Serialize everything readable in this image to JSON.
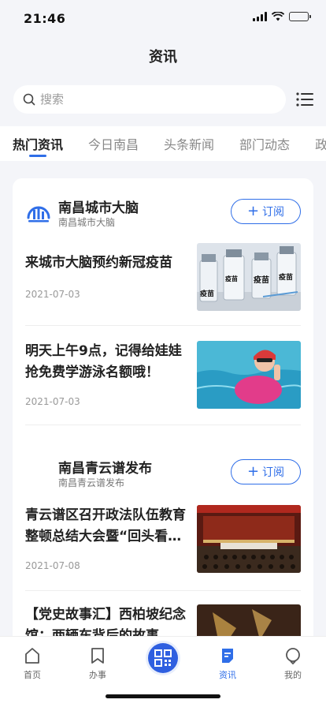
{
  "status_bar": {
    "time": "21:46"
  },
  "header": {
    "title": "资讯"
  },
  "search": {
    "placeholder": "搜索"
  },
  "tabs": [
    {
      "label": "热门资讯",
      "active": true
    },
    {
      "label": "今日南昌",
      "active": false
    },
    {
      "label": "头条新闻",
      "active": false
    },
    {
      "label": "部门动态",
      "active": false
    },
    {
      "label": "政",
      "active": false
    }
  ],
  "channels": [
    {
      "name": "南昌城市大脑",
      "subtitle": "南昌城市大脑",
      "subscribe_label": "订阅",
      "articles": [
        {
          "title": "来城市大脑预约新冠疫苗",
          "date": "2021-07-03",
          "thumb_texts": [
            "疫苗",
            "疫苗",
            "疫苗",
            "疫苗"
          ]
        },
        {
          "title": "明天上午9点，记得给娃娃抢免费学游泳名额哦！",
          "date": "2021-07-03"
        }
      ]
    },
    {
      "name": "南昌青云谱发布",
      "subtitle": "南昌青云谱发布",
      "subscribe_label": "订阅",
      "articles": [
        {
          "title": "青云谱区召开政法队伍教育整顿总结大会暨“回头看…",
          "date": "2021-07-08"
        },
        {
          "title": "【党史故事汇】西柏坡纪念馆：两辆车背后的故事",
          "date": ""
        }
      ]
    }
  ],
  "bottom_nav": [
    {
      "label": "首页",
      "icon": "home-icon",
      "active": false
    },
    {
      "label": "办事",
      "icon": "bookmark-icon",
      "active": false
    },
    {
      "label": "",
      "icon": "qr-code-icon",
      "active": false
    },
    {
      "label": "资讯",
      "icon": "news-icon",
      "active": true
    },
    {
      "label": "我的",
      "icon": "user-icon",
      "active": false
    }
  ],
  "colors": {
    "accent": "#2f6ee8",
    "background": "#f4f5f9"
  }
}
